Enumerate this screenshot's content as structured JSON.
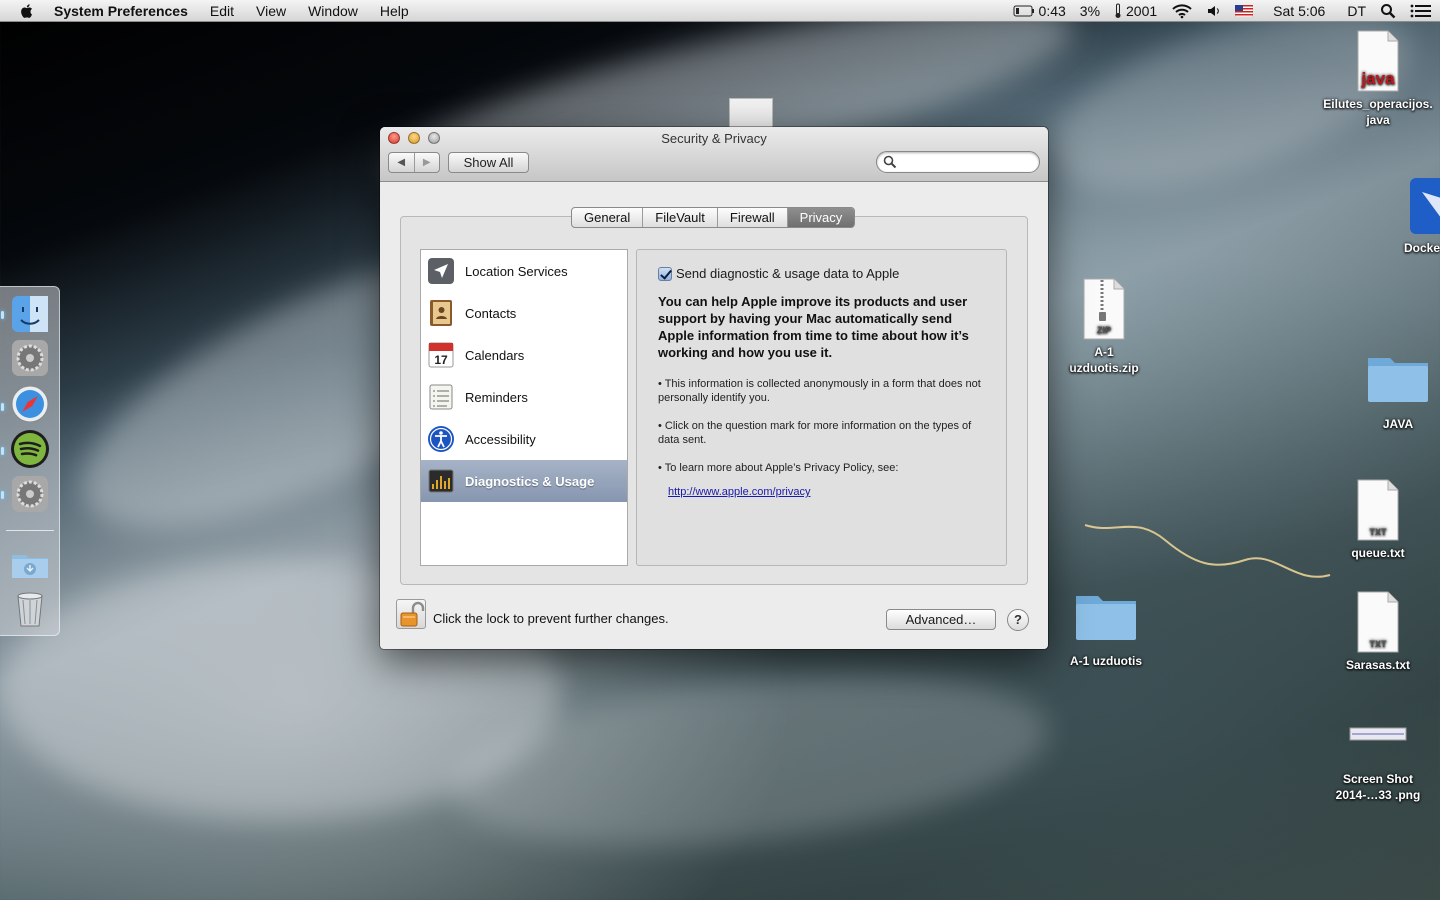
{
  "menubar": {
    "app_name": "System Preferences",
    "items": [
      "Edit",
      "View",
      "Window",
      "Help"
    ],
    "status": {
      "battery_time": "0:43",
      "battery_percent": "3%",
      "temp_number": "2001",
      "clock": "Sat 5:06",
      "user_initials": "DT"
    }
  },
  "window": {
    "title": "Security & Privacy",
    "show_all_label": "Show All",
    "search_placeholder": "",
    "tabs": [
      "General",
      "FileVault",
      "Firewall",
      "Privacy"
    ],
    "active_tab": "Privacy",
    "list_items": [
      {
        "label": "Location Services",
        "icon": "location-arrow-icon"
      },
      {
        "label": "Contacts",
        "icon": "contacts-book-icon"
      },
      {
        "label": "Calendars",
        "icon": "calendar-icon",
        "icon_text": "17"
      },
      {
        "label": "Reminders",
        "icon": "reminders-list-icon"
      },
      {
        "label": "Accessibility",
        "icon": "accessibility-icon"
      },
      {
        "label": "Diagnostics & Usage",
        "icon": "diagnostics-console-icon",
        "selected": true
      }
    ],
    "detail": {
      "checkbox_label": "Send diagnostic & usage data to Apple",
      "checkbox_checked": true,
      "intro": "You can help Apple improve its products and user support by having your Mac automatically send Apple information from time to time about how it’s working and how you use it.",
      "bullet1": "• This information is collected anonymously in a form that does not personally identify you.",
      "bullet2": "• Click on the question mark for more information on the types of data sent.",
      "bullet3": "• To learn more about Apple’s Privacy Policy, see:",
      "link": "http://www.apple.com/privacy"
    },
    "footer": {
      "lock_text": "Click the lock to prevent further changes.",
      "advanced_label": "Advanced…",
      "help_label": "?"
    }
  },
  "desktop_icons": {
    "java_file": {
      "badge": "java",
      "label": "Eilutes_operacijos.java"
    },
    "docker": {
      "label": "Docke"
    },
    "zip_file": {
      "badge": "ZIP",
      "label": "A-1 uzduotis.zip"
    },
    "java_folder": {
      "label": "JAVA"
    },
    "queue_txt": {
      "badge": "TXT",
      "label": "queue.txt"
    },
    "folder_a1": {
      "label": "A-1 uzduotis"
    },
    "sarasas_txt": {
      "badge": "TXT",
      "label": "Sarasas.txt"
    },
    "screenshot": {
      "label": "Screen Shot 2014-…33 .png"
    }
  },
  "dock_items": [
    "finder-icon",
    "system-preferences-icon",
    "safari-icon",
    "spotify-icon",
    "system-preferences-icon",
    "downloads-folder-icon",
    "trash-icon"
  ],
  "colors": {
    "selection": "#8796b0",
    "link": "#1a1aa8",
    "close": "#d93a2b",
    "minimize": "#d9991f"
  }
}
